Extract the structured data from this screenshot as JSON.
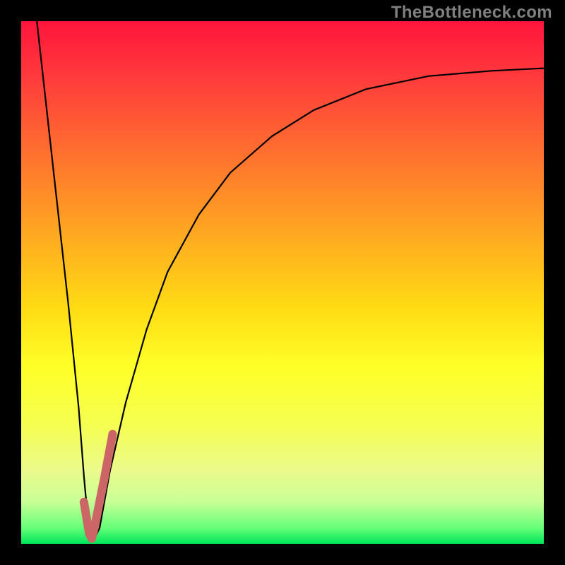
{
  "watermark": "TheBottleneck.com",
  "chart_data": {
    "type": "line",
    "title": "",
    "xlabel": "",
    "ylabel": "",
    "xlim": [
      0,
      100
    ],
    "ylim": [
      0,
      100
    ],
    "series": [
      {
        "name": "bottleneck-curve",
        "x": [
          3,
          5,
          7,
          9,
          11,
          12,
          13,
          14,
          15,
          17,
          20,
          24,
          28,
          34,
          40,
          48,
          56,
          66,
          78,
          90,
          100
        ],
        "values": [
          100,
          82,
          64,
          46,
          26,
          13,
          2,
          1,
          3,
          14,
          27,
          41,
          52,
          63,
          71,
          78,
          83,
          87,
          89.5,
          90.5,
          91
        ]
      },
      {
        "name": "highlight-segment",
        "x": [
          12,
          13,
          13.5,
          14,
          15,
          16,
          17.5
        ],
        "values": [
          8,
          2,
          1,
          3,
          8,
          13,
          21
        ]
      }
    ],
    "colors": {
      "curve": "#000000",
      "highlight": "#cc6666"
    }
  }
}
